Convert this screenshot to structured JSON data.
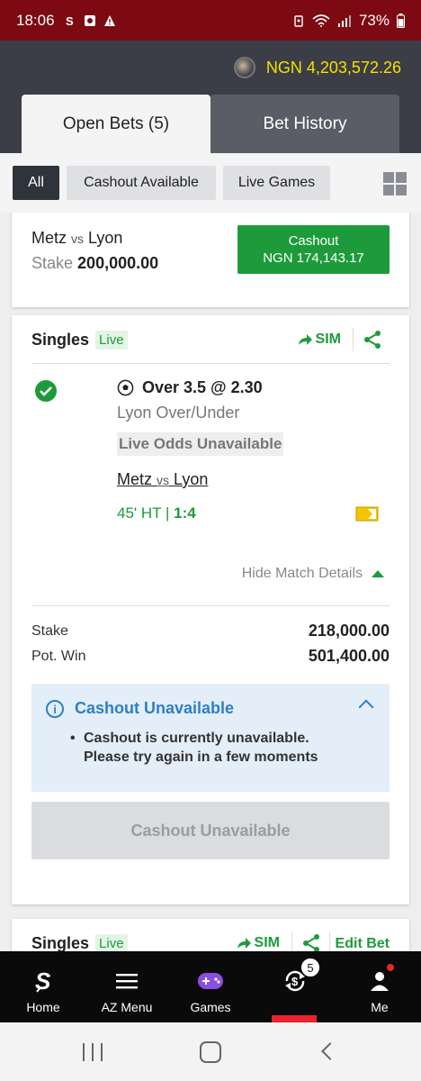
{
  "status_bar": {
    "time": "18:06",
    "battery": "73%"
  },
  "header": {
    "balance": "NGN 4,203,572.26",
    "tabs": [
      {
        "label": "Open Bets (5)",
        "active": true
      },
      {
        "label": "Bet History",
        "active": false
      }
    ]
  },
  "filters": {
    "chips": [
      {
        "label": "All",
        "active": true
      },
      {
        "label": "Cashout Available",
        "active": false
      },
      {
        "label": "Live Games",
        "active": false
      }
    ]
  },
  "card1": {
    "home": "Metz",
    "vs": "vs",
    "away": "Lyon",
    "stake_label": "Stake",
    "stake_value": "200,000.00",
    "cashout_label": "Cashout",
    "cashout_amount": "NGN 174,143.17"
  },
  "card2": {
    "title": "Singles",
    "live_label": "Live",
    "sim_label": "SIM",
    "selection": "Over 3.5 @ 2.30",
    "market": "Lyon Over/Under",
    "odds_status": "Live Odds Unavailable",
    "home": "Metz",
    "vs": "vs",
    "away": "Lyon",
    "match_time": "45' HT |",
    "score": "1:4",
    "hide_details": "Hide Match Details",
    "stake_label": "Stake",
    "stake_value": "218,000.00",
    "potwin_label": "Pot. Win",
    "potwin_value": "501,400.00",
    "info": {
      "title": "Cashout Unavailable",
      "message_line1": "Cashout is currently unavailable.",
      "message_line2": "Please try again in a few moments"
    },
    "cashout_button": "Cashout Unavailable"
  },
  "card3": {
    "title": "Singles",
    "live_label": "Live",
    "sim_label": "SIM",
    "edit_label": "Edit Bet"
  },
  "bottom_nav": {
    "items": [
      {
        "label": "Home",
        "icon": "sportybet-logo-icon"
      },
      {
        "label": "AZ Menu",
        "icon": "menu-icon"
      },
      {
        "label": "Games",
        "icon": "gamepad-icon"
      },
      {
        "label": "",
        "icon": "cashout-icon",
        "badge": "5",
        "active": true
      },
      {
        "label": "Me",
        "icon": "user-icon"
      }
    ]
  },
  "colors": {
    "status_bar": "#7d0a12",
    "header": "#3b3e46",
    "balance": "#f7e000",
    "accent_green": "#1d9b3a",
    "info_blue": "#2f7fc7",
    "active_red": "#e8242e"
  }
}
